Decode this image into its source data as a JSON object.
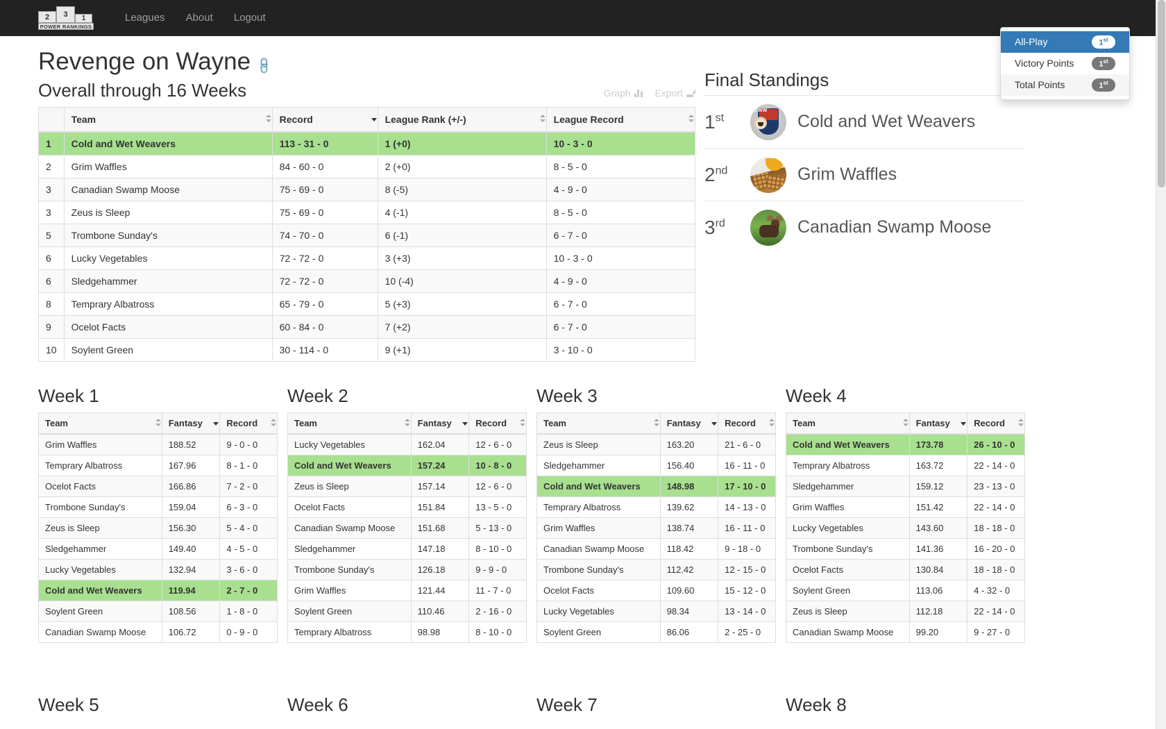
{
  "navbar": {
    "brand": {
      "block2": "2",
      "block3": "3",
      "block1": "1",
      "base_label": "POWER RANKINGS"
    },
    "links": [
      {
        "label": "Leagues"
      },
      {
        "label": "About"
      },
      {
        "label": "Logout"
      }
    ]
  },
  "header": {
    "title": "Revenge on Wayne",
    "link_icon": "link-icon",
    "subtitle": "Overall through 16 Weeks",
    "tools": [
      {
        "label": "Graph",
        "icon": "bar-chart-icon"
      },
      {
        "label": "Export",
        "icon": "export-icon"
      }
    ]
  },
  "scoring_dropdown": {
    "button_label": "All-Play",
    "items": [
      {
        "label": "All-Play",
        "badge": "1",
        "badge_suffix": "st",
        "active": true
      },
      {
        "label": "Victory Points",
        "badge": "1",
        "badge_suffix": "st",
        "active": false
      },
      {
        "label": "Total Points",
        "badge": "1",
        "badge_suffix": "st",
        "active": false
      }
    ]
  },
  "main_table": {
    "columns": [
      {
        "label": "",
        "sort": "none"
      },
      {
        "label": "Team",
        "sort": "neutral"
      },
      {
        "label": "Record",
        "sort": "desc"
      },
      {
        "label": "League Rank (+/-)",
        "sort": "neutral"
      },
      {
        "label": "League Record",
        "sort": "neutral"
      }
    ],
    "rows": [
      {
        "rank": "1",
        "team": "Cold and Wet Weavers",
        "record": "113 - 31 - 0",
        "league_rank": "1 (+0)",
        "league_record": "10 - 3 - 0",
        "highlight": true
      },
      {
        "rank": "2",
        "team": "Grim Waffles",
        "record": "84 - 60 - 0",
        "league_rank": "2 (+0)",
        "league_record": "8 - 5 - 0",
        "highlight": false
      },
      {
        "rank": "3",
        "team": "Canadian Swamp Moose",
        "record": "75 - 69 - 0",
        "league_rank": "8 (-5)",
        "league_record": "4 - 9 - 0",
        "highlight": false
      },
      {
        "rank": "3",
        "team": "Zeus is Sleep",
        "record": "75 - 69 - 0",
        "league_rank": "4 (-1)",
        "league_record": "8 - 5 - 0",
        "highlight": false
      },
      {
        "rank": "5",
        "team": "Trombone Sunday's",
        "record": "74 - 70 - 0",
        "league_rank": "6 (-1)",
        "league_record": "6 - 7 - 0",
        "highlight": false
      },
      {
        "rank": "6",
        "team": "Lucky Vegetables",
        "record": "72 - 72 - 0",
        "league_rank": "3 (+3)",
        "league_record": "10 - 3 - 0",
        "highlight": false
      },
      {
        "rank": "6",
        "team": "Sledgehammer",
        "record": "72 - 72 - 0",
        "league_rank": "10 (-4)",
        "league_record": "4 - 9 - 0",
        "highlight": false
      },
      {
        "rank": "8",
        "team": "Temprary Albatross",
        "record": "65 - 79 - 0",
        "league_rank": "5 (+3)",
        "league_record": "6 - 7 - 0",
        "highlight": false
      },
      {
        "rank": "9",
        "team": "Ocelot Facts",
        "record": "60 - 84 - 0",
        "league_rank": "7 (+2)",
        "league_record": "6 - 7 - 0",
        "highlight": false
      },
      {
        "rank": "10",
        "team": "Soylent Green",
        "record": "30 - 114 - 0",
        "league_rank": "9 (+1)",
        "league_record": "3 - 10 - 0",
        "highlight": false
      }
    ]
  },
  "final_standings": {
    "title": "Final Standings",
    "rows": [
      {
        "place": "1",
        "place_suffix": "st",
        "team": "Cold and Wet Weavers",
        "avatar": "shield-crest-avatar"
      },
      {
        "place": "2",
        "place_suffix": "nd",
        "team": "Grim Waffles",
        "avatar": "waffles-avatar"
      },
      {
        "place": "3",
        "place_suffix": "rd",
        "team": "Canadian Swamp Moose",
        "avatar": "moose-avatar"
      }
    ]
  },
  "week_columns": [
    {
      "label": "Team",
      "sort": "neutral"
    },
    {
      "label": "Fantasy",
      "sort": "desc"
    },
    {
      "label": "Record",
      "sort": "neutral"
    }
  ],
  "weeks": [
    {
      "title": "Week 1",
      "rows": [
        {
          "team": "Grim Waffles",
          "fantasy": "188.52",
          "record": "9 - 0 - 0",
          "highlight": false
        },
        {
          "team": "Temprary Albatross",
          "fantasy": "167.96",
          "record": "8 - 1 - 0",
          "highlight": false
        },
        {
          "team": "Ocelot Facts",
          "fantasy": "166.86",
          "record": "7 - 2 - 0",
          "highlight": false
        },
        {
          "team": "Trombone Sunday's",
          "fantasy": "159.04",
          "record": "6 - 3 - 0",
          "highlight": false
        },
        {
          "team": "Zeus is Sleep",
          "fantasy": "156.30",
          "record": "5 - 4 - 0",
          "highlight": false
        },
        {
          "team": "Sledgehammer",
          "fantasy": "149.40",
          "record": "4 - 5 - 0",
          "highlight": false
        },
        {
          "team": "Lucky Vegetables",
          "fantasy": "132.94",
          "record": "3 - 6 - 0",
          "highlight": false
        },
        {
          "team": "Cold and Wet Weavers",
          "fantasy": "119.94",
          "record": "2 - 7 - 0",
          "highlight": true
        },
        {
          "team": "Soylent Green",
          "fantasy": "108.56",
          "record": "1 - 8 - 0",
          "highlight": false
        },
        {
          "team": "Canadian Swamp Moose",
          "fantasy": "106.72",
          "record": "0 - 9 - 0",
          "highlight": false
        }
      ]
    },
    {
      "title": "Week 2",
      "rows": [
        {
          "team": "Lucky Vegetables",
          "fantasy": "162.04",
          "record": "12 - 6 - 0",
          "highlight": false
        },
        {
          "team": "Cold and Wet Weavers",
          "fantasy": "157.24",
          "record": "10 - 8 - 0",
          "highlight": true
        },
        {
          "team": "Zeus is Sleep",
          "fantasy": "157.14",
          "record": "12 - 6 - 0",
          "highlight": false
        },
        {
          "team": "Ocelot Facts",
          "fantasy": "151.84",
          "record": "13 - 5 - 0",
          "highlight": false
        },
        {
          "team": "Canadian Swamp Moose",
          "fantasy": "151.68",
          "record": "5 - 13 - 0",
          "highlight": false
        },
        {
          "team": "Sledgehammer",
          "fantasy": "147.18",
          "record": "8 - 10 - 0",
          "highlight": false
        },
        {
          "team": "Trombone Sunday's",
          "fantasy": "126.18",
          "record": "9 - 9 - 0",
          "highlight": false
        },
        {
          "team": "Grim Waffles",
          "fantasy": "121.44",
          "record": "11 - 7 - 0",
          "highlight": false
        },
        {
          "team": "Soylent Green",
          "fantasy": "110.46",
          "record": "2 - 16 - 0",
          "highlight": false
        },
        {
          "team": "Temprary Albatross",
          "fantasy": "98.98",
          "record": "8 - 10 - 0",
          "highlight": false
        }
      ]
    },
    {
      "title": "Week 3",
      "rows": [
        {
          "team": "Zeus is Sleep",
          "fantasy": "163.20",
          "record": "21 - 6 - 0",
          "highlight": false
        },
        {
          "team": "Sledgehammer",
          "fantasy": "156.40",
          "record": "16 - 11 - 0",
          "highlight": false
        },
        {
          "team": "Cold and Wet Weavers",
          "fantasy": "148.98",
          "record": "17 - 10 - 0",
          "highlight": true
        },
        {
          "team": "Temprary Albatross",
          "fantasy": "139.62",
          "record": "14 - 13 - 0",
          "highlight": false
        },
        {
          "team": "Grim Waffles",
          "fantasy": "138.74",
          "record": "16 - 11 - 0",
          "highlight": false
        },
        {
          "team": "Canadian Swamp Moose",
          "fantasy": "118.42",
          "record": "9 - 18 - 0",
          "highlight": false
        },
        {
          "team": "Trombone Sunday's",
          "fantasy": "112.42",
          "record": "12 - 15 - 0",
          "highlight": false
        },
        {
          "team": "Ocelot Facts",
          "fantasy": "109.60",
          "record": "15 - 12 - 0",
          "highlight": false
        },
        {
          "team": "Lucky Vegetables",
          "fantasy": "98.34",
          "record": "13 - 14 - 0",
          "highlight": false
        },
        {
          "team": "Soylent Green",
          "fantasy": "86.06",
          "record": "2 - 25 - 0",
          "highlight": false
        }
      ]
    },
    {
      "title": "Week 4",
      "rows": [
        {
          "team": "Cold and Wet Weavers",
          "fantasy": "173.78",
          "record": "26 - 10 - 0",
          "highlight": true
        },
        {
          "team": "Temprary Albatross",
          "fantasy": "163.72",
          "record": "22 - 14 - 0",
          "highlight": false
        },
        {
          "team": "Sledgehammer",
          "fantasy": "159.12",
          "record": "23 - 13 - 0",
          "highlight": false
        },
        {
          "team": "Grim Waffles",
          "fantasy": "151.42",
          "record": "22 - 14 - 0",
          "highlight": false
        },
        {
          "team": "Lucky Vegetables",
          "fantasy": "143.60",
          "record": "18 - 18 - 0",
          "highlight": false
        },
        {
          "team": "Trombone Sunday's",
          "fantasy": "141.36",
          "record": "16 - 20 - 0",
          "highlight": false
        },
        {
          "team": "Ocelot Facts",
          "fantasy": "130.84",
          "record": "18 - 18 - 0",
          "highlight": false
        },
        {
          "team": "Soylent Green",
          "fantasy": "113.06",
          "record": "4 - 32 - 0",
          "highlight": false
        },
        {
          "team": "Zeus is Sleep",
          "fantasy": "112.18",
          "record": "22 - 14 - 0",
          "highlight": false
        },
        {
          "team": "Canadian Swamp Moose",
          "fantasy": "99.20",
          "record": "9 - 27 - 0",
          "highlight": false
        }
      ]
    }
  ],
  "next_week_titles": [
    {
      "title": "Week 5"
    },
    {
      "title": "Week 6"
    },
    {
      "title": "Week 7"
    },
    {
      "title": "Week 8"
    }
  ],
  "colors": {
    "navbar_bg": "#222222",
    "highlight_row": "#a8e08f",
    "dropdown_active": "#337ab7",
    "badge_gray": "#777777"
  }
}
